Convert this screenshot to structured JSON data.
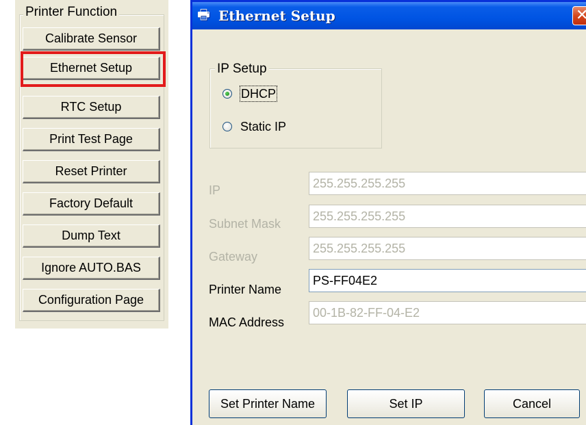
{
  "printer_function": {
    "title": "Printer Function",
    "buttons": [
      {
        "label": "Calibrate Sensor"
      },
      {
        "label": "Ethernet Setup"
      },
      {
        "label": "RTC Setup"
      },
      {
        "label": "Print Test Page"
      },
      {
        "label": "Reset Printer"
      },
      {
        "label": "Factory Default"
      },
      {
        "label": "Dump Text"
      },
      {
        "label": "Ignore AUTO.BAS"
      },
      {
        "label": "Configuration Page"
      }
    ],
    "highlighted": "Ethernet Setup"
  },
  "dialog": {
    "title": "Ethernet Setup",
    "title_icon": "printer-icon",
    "close_label": "✕",
    "ip_setup": {
      "legend": "IP Setup",
      "options": [
        {
          "label": "DHCP",
          "selected": true
        },
        {
          "label": "Static IP",
          "selected": false
        }
      ]
    },
    "fields": {
      "ip": {
        "label": "IP",
        "value": "255.255.255.255",
        "enabled": false
      },
      "subnet": {
        "label": "Subnet Mask",
        "value": "255.255.255.255",
        "enabled": false
      },
      "gateway": {
        "label": "Gateway",
        "value": "255.255.255.255",
        "enabled": false
      },
      "printer_name": {
        "label": "Printer Name",
        "value": "PS-FF04E2",
        "enabled": true
      },
      "mac": {
        "label": "MAC Address",
        "value": "00-1B-82-FF-04-E2",
        "enabled": false
      }
    },
    "buttons": {
      "set_name": "Set Printer Name",
      "set_ip": "Set IP",
      "cancel": "Cancel"
    }
  },
  "colors": {
    "highlight": "#e21b1b",
    "titlebar": "#0054e3",
    "face": "#ece9d8"
  }
}
